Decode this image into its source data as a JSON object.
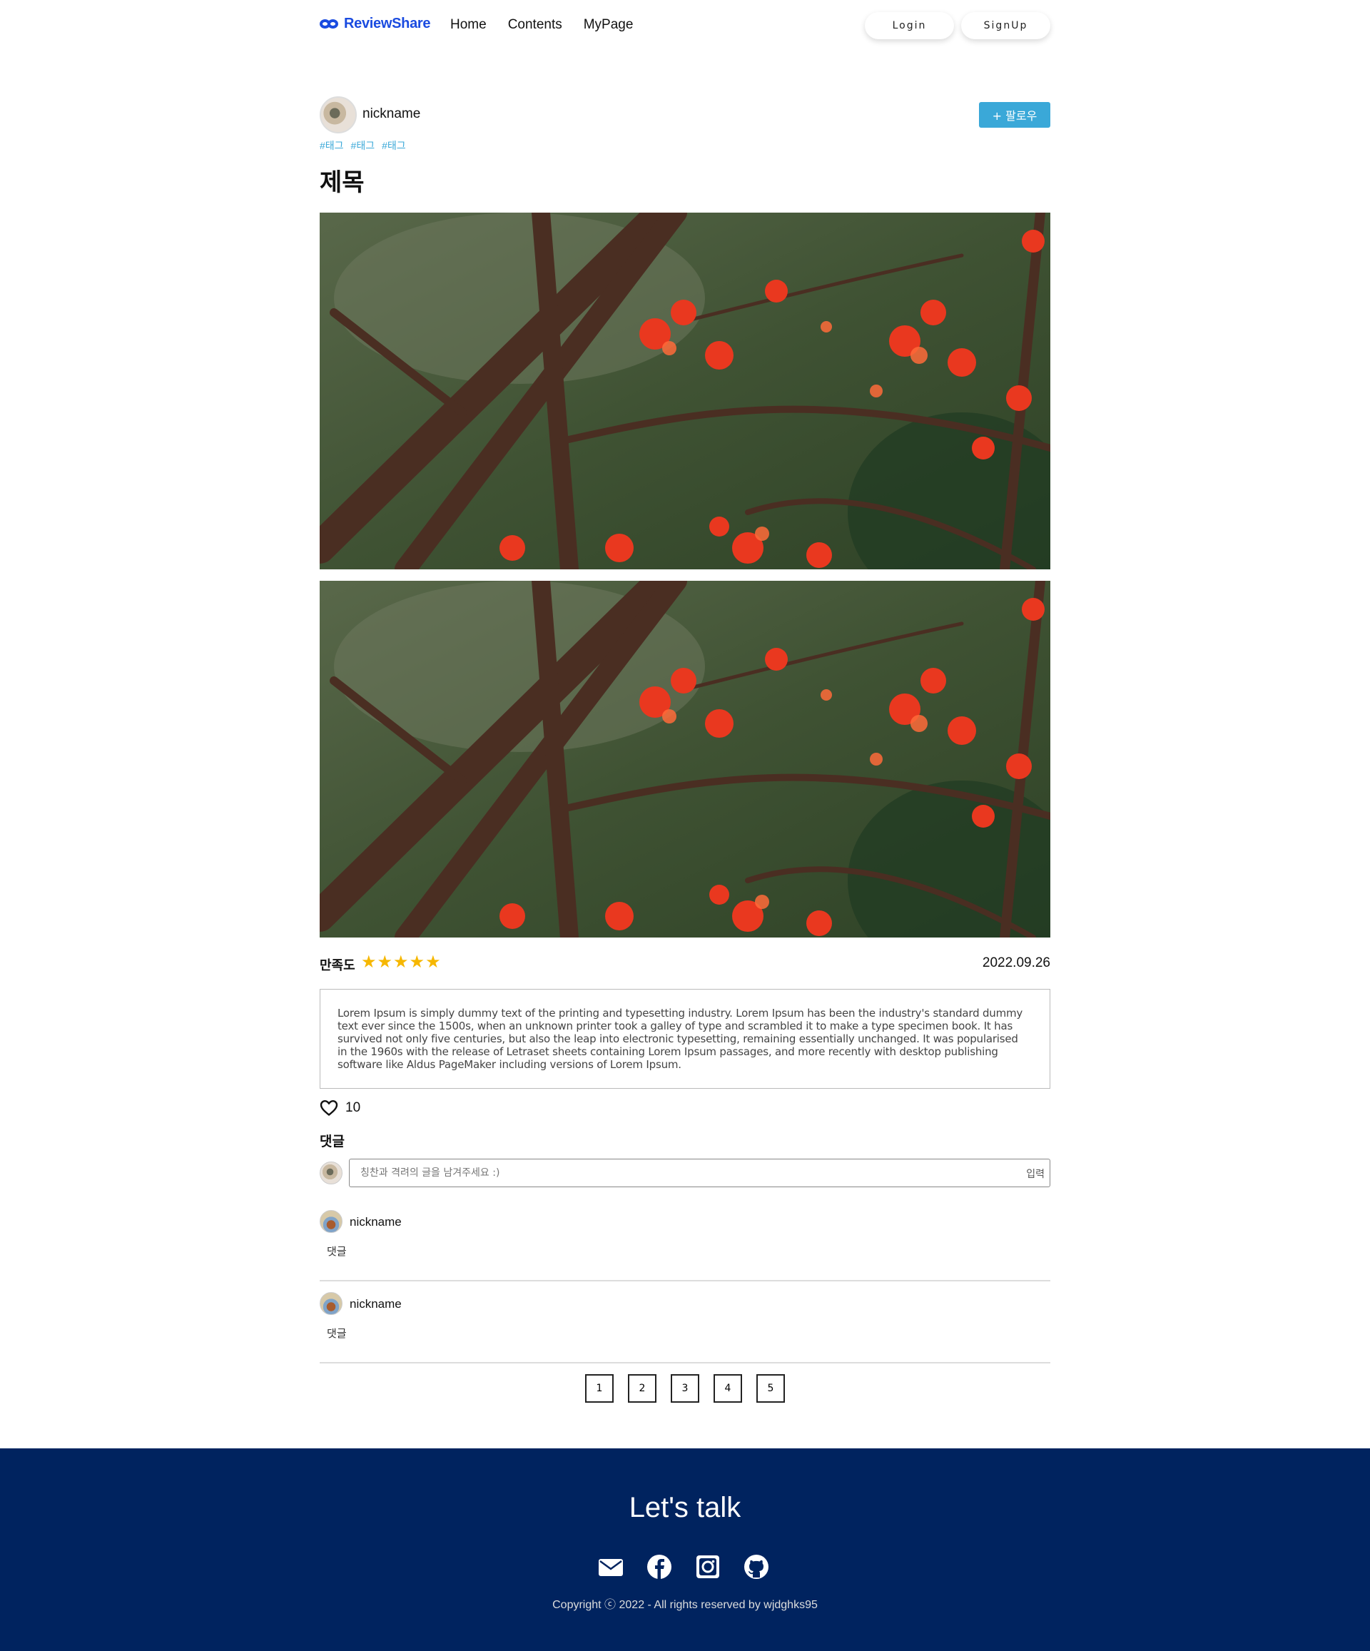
{
  "header": {
    "logo_text": "ReviewShare",
    "nav": [
      "Home",
      "Contents",
      "MyPage"
    ],
    "login_label": "Login",
    "signup_label": "SignUp"
  },
  "post": {
    "author_nickname": "nickname",
    "follow_label": "+ 팔로우",
    "tags": [
      "#태그",
      "#태그",
      "#태그"
    ],
    "title": "제목",
    "rating_label": "만족도",
    "rating_stars": 5,
    "date": "2022.09.26",
    "description": "Lorem Ipsum is simply dummy text of the printing and typesetting industry. Lorem Ipsum has been the industry's standard dummy text ever since the 1500s, when an unknown printer took a galley of type and scrambled it to make a type specimen book. It has survived not only five centuries, but also the leap into electronic typesetting, remaining essentially unchanged. It was popularised in the 1960s with the release of Letraset sheets containing Lorem Ipsum passages, and more recently with desktop publishing software like Aldus PageMaker including versions of Lorem Ipsum.",
    "likes": "10"
  },
  "comments": {
    "title": "댓글",
    "input_placeholder": "칭찬과 격려의 글을 남겨주세요 :)",
    "submit_label": "입력",
    "items": [
      {
        "nickname": "nickname",
        "text": "댓글"
      },
      {
        "nickname": "nickname",
        "text": "댓글"
      }
    ]
  },
  "pagination": [
    "1",
    "2",
    "3",
    "4",
    "5"
  ],
  "footer": {
    "title": "Let's talk",
    "icons": [
      "mail-icon",
      "facebook-icon",
      "instagram-icon",
      "github-icon"
    ],
    "copyright": "Copyright ⓒ 2022 - All rights reserved by wjdghks95"
  },
  "colors": {
    "brand": "#1a4be0",
    "follow": "#3aa8d8",
    "star": "#f6b700",
    "footer_bg": "#00235f"
  }
}
